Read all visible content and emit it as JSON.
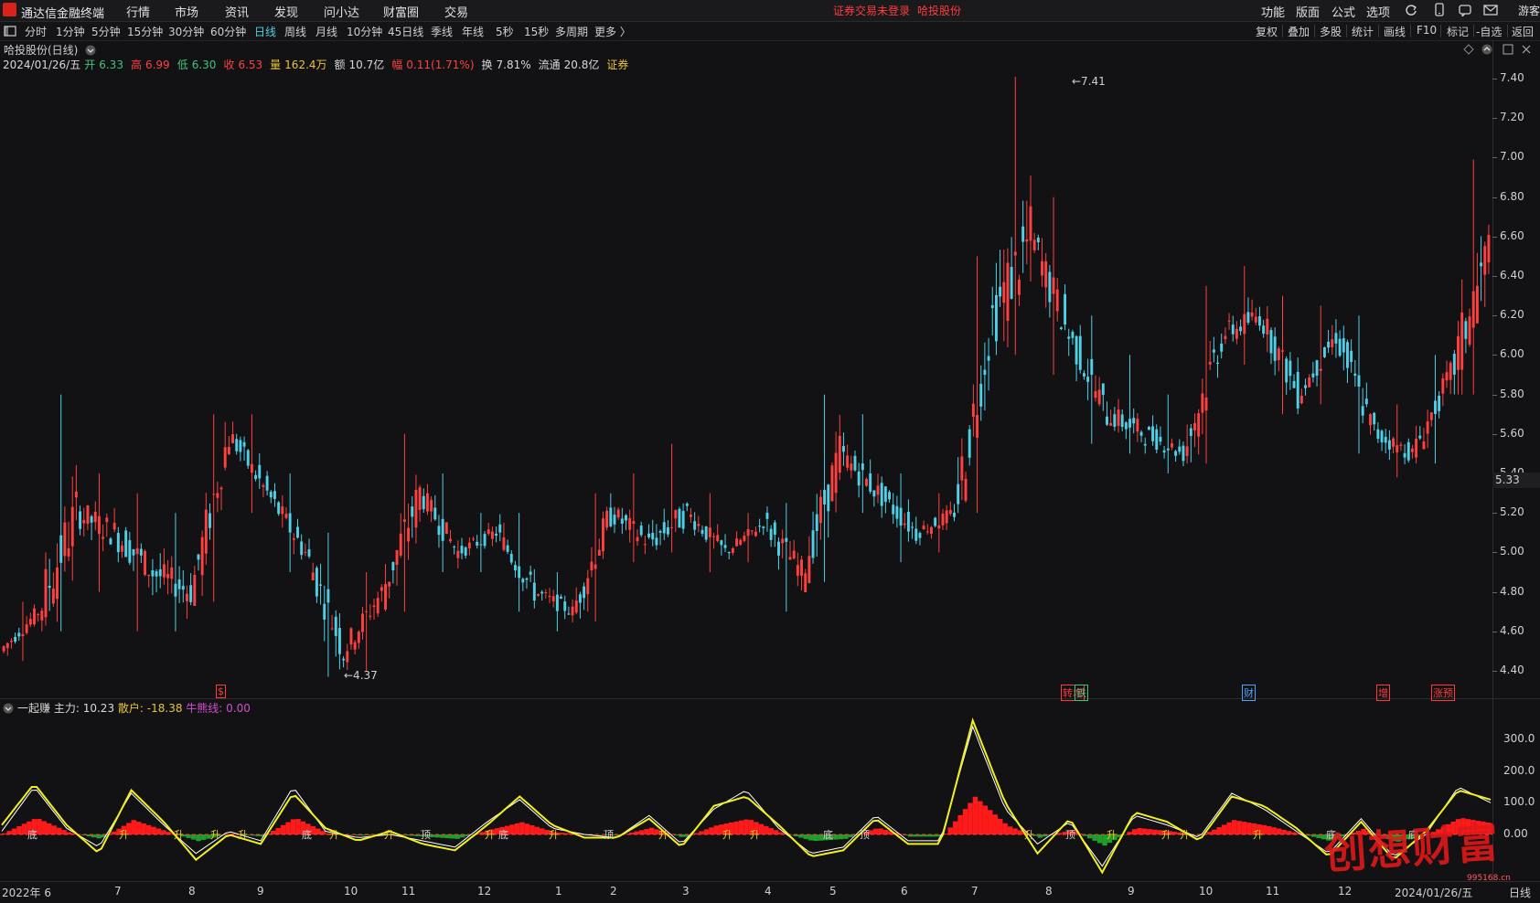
{
  "menu": {
    "app_title": "通达信金融终端",
    "items": [
      "行情",
      "市场",
      "资讯",
      "发现",
      "问小达",
      "财富圈",
      "交易"
    ],
    "login_status": "证券交易未登录",
    "stock_name": "哈投股份",
    "right_items": [
      "功能",
      "版面",
      "公式",
      "选项"
    ],
    "user": "游客"
  },
  "periods": [
    "分时",
    "1分钟",
    "5分钟",
    "15分钟",
    "30分钟",
    "60分钟",
    "日线",
    "周线",
    "月线",
    "10分钟",
    "45日线",
    "季线",
    "年线",
    "5秒",
    "15秒",
    "多周期",
    "更多 〉"
  ],
  "active_period": "日线",
  "tools": [
    "复权",
    "叠加",
    "多股",
    "统计",
    "画线",
    "F10",
    "标记",
    "-自选",
    "返回"
  ],
  "chart": {
    "title": "哈投股份(日线)",
    "date": "2024/01/26/五",
    "open_label": "开",
    "open": "6.33",
    "high_label": "高",
    "high": "6.99",
    "low_label": "低",
    "low": "6.30",
    "close_label": "收",
    "close": "6.53",
    "volume_label": "量",
    "volume": "162.4万",
    "amount_label": "额",
    "amount": "10.7亿",
    "change_label": "幅",
    "change": "0.11(1.71%)",
    "turnover_label": "换",
    "turnover": "7.81%",
    "float_label": "流通",
    "float_cap": "20.8亿",
    "sector": "证券",
    "max_label": "7.41",
    "min_label": "4.37",
    "current_price_tag": "5.33"
  },
  "price_axis": [
    "7.40",
    "7.20",
    "7.00",
    "6.80",
    "6.60",
    "6.40",
    "6.20",
    "6.00",
    "5.80",
    "5.60",
    "5.40",
    "5.20",
    "5.00",
    "4.80",
    "4.60",
    "4.40"
  ],
  "event_markers": [
    {
      "label": "$",
      "color": "#ff3b3b"
    },
    {
      "label": "转增",
      "color": "#ff3b3b"
    },
    {
      "label": "铁",
      "color": "#3fc37a"
    },
    {
      "label": "财",
      "color": "#4fa3ff"
    },
    {
      "label": "增",
      "color": "#ff3b3b"
    },
    {
      "label": "涨预",
      "color": "#ff3b3b"
    }
  ],
  "indicator": {
    "name": "一起赚",
    "main_label": "主力:",
    "main_value": "10.23",
    "retail_label": "散户:",
    "retail_value": "-18.38",
    "bull_label": "牛熊线:",
    "bull_value": "0.00",
    "axis": [
      "300.0",
      "200.0",
      "100.0",
      "0.00"
    ],
    "signal_labels": [
      "升",
      "顶",
      "底"
    ]
  },
  "date_axis": [
    "2022年 6",
    "7",
    "8",
    "9",
    "10",
    "11",
    "12",
    "1",
    "2",
    "3",
    "4",
    "5",
    "6",
    "7",
    "8",
    "9",
    "10",
    "11",
    "12",
    "2024/01/26/五",
    "日线"
  ],
  "watermark": "创想财富",
  "watermark_url": "995168.cn",
  "colors": {
    "up": "#ff4040",
    "down": "#4fd0e6",
    "retail_line": "#f0f020",
    "main_line": "#ffffff",
    "hist_up": "#ff1a1a",
    "hist_down": "#1f9e2a"
  },
  "chart_data": {
    "type": "candlestick",
    "ylim": [
      4.3,
      7.5
    ],
    "ohlc_keypoints": [
      [
        4.5,
        4.75,
        4.45,
        4.7
      ],
      [
        4.7,
        5.8,
        4.6,
        5.2
      ],
      [
        5.2,
        5.4,
        4.8,
        5.1
      ],
      [
        5.1,
        5.3,
        4.6,
        4.9
      ],
      [
        4.9,
        5.2,
        4.6,
        4.8
      ],
      [
        4.8,
        5.7,
        4.75,
        5.6
      ],
      [
        5.6,
        5.7,
        5.2,
        5.3
      ],
      [
        5.3,
        5.4,
        4.9,
        5.0
      ],
      [
        5.0,
        5.1,
        4.37,
        4.5
      ],
      [
        4.5,
        4.9,
        4.4,
        4.8
      ],
      [
        4.8,
        5.6,
        4.7,
        5.3
      ],
      [
        5.3,
        5.4,
        4.9,
        5.0
      ],
      [
        5.0,
        5.2,
        4.9,
        5.1
      ],
      [
        5.1,
        5.2,
        4.7,
        4.8
      ],
      [
        4.8,
        4.9,
        4.6,
        4.7
      ],
      [
        4.7,
        5.3,
        4.65,
        5.2
      ],
      [
        5.2,
        5.4,
        4.95,
        5.05
      ],
      [
        5.05,
        5.55,
        5.0,
        5.2
      ],
      [
        5.2,
        5.3,
        4.9,
        5.0
      ],
      [
        5.0,
        5.2,
        4.95,
        5.15
      ],
      [
        5.15,
        5.25,
        4.7,
        4.9
      ],
      [
        4.9,
        5.8,
        4.85,
        5.5
      ],
      [
        5.5,
        5.7,
        5.2,
        5.3
      ],
      [
        5.3,
        5.4,
        4.95,
        5.1
      ],
      [
        5.1,
        5.3,
        5.0,
        5.2
      ],
      [
        5.2,
        6.5,
        5.2,
        6.2
      ],
      [
        6.2,
        7.41,
        6.0,
        6.6
      ],
      [
        6.6,
        6.8,
        5.9,
        6.1
      ],
      [
        6.1,
        6.2,
        5.55,
        5.7
      ],
      [
        5.7,
        6.0,
        5.5,
        5.6
      ],
      [
        5.6,
        5.8,
        5.4,
        5.5
      ],
      [
        5.5,
        6.35,
        5.45,
        6.1
      ],
      [
        6.1,
        6.45,
        5.95,
        6.2
      ],
      [
        6.2,
        6.3,
        5.7,
        5.8
      ],
      [
        5.8,
        6.25,
        5.75,
        6.1
      ],
      [
        6.1,
        6.2,
        5.5,
        5.6
      ],
      [
        5.6,
        5.75,
        5.38,
        5.5
      ],
      [
        5.5,
        6.0,
        5.45,
        5.9
      ],
      [
        5.9,
        6.99,
        5.8,
        6.53
      ]
    ],
    "indicator_series": [
      {
        "name": "主力",
        "values": [
          10,
          150,
          20,
          -40,
          130,
          30,
          -60,
          10,
          -20,
          150,
          10,
          -10,
          0,
          -20,
          -40,
          40,
          110,
          20,
          0,
          -10,
          60,
          -30,
          80,
          140,
          20,
          -60,
          -40,
          60,
          -20,
          -20,
          340,
          80,
          -30,
          40,
          -100,
          60,
          30,
          -10,
          130,
          80,
          10,
          -60,
          50,
          -70,
          0,
          150,
          100
        ]
      },
      {
        "name": "散户",
        "values": [
          30,
          160,
          30,
          -60,
          140,
          40,
          -80,
          0,
          -30,
          130,
          20,
          -20,
          10,
          -30,
          -50,
          30,
          120,
          30,
          -10,
          -10,
          50,
          -40,
          90,
          120,
          30,
          -70,
          -50,
          50,
          -30,
          -30,
          360,
          100,
          -60,
          50,
          -120,
          70,
          40,
          -20,
          120,
          90,
          20,
          -70,
          40,
          -80,
          10,
          140,
          110
        ]
      }
    ]
  }
}
